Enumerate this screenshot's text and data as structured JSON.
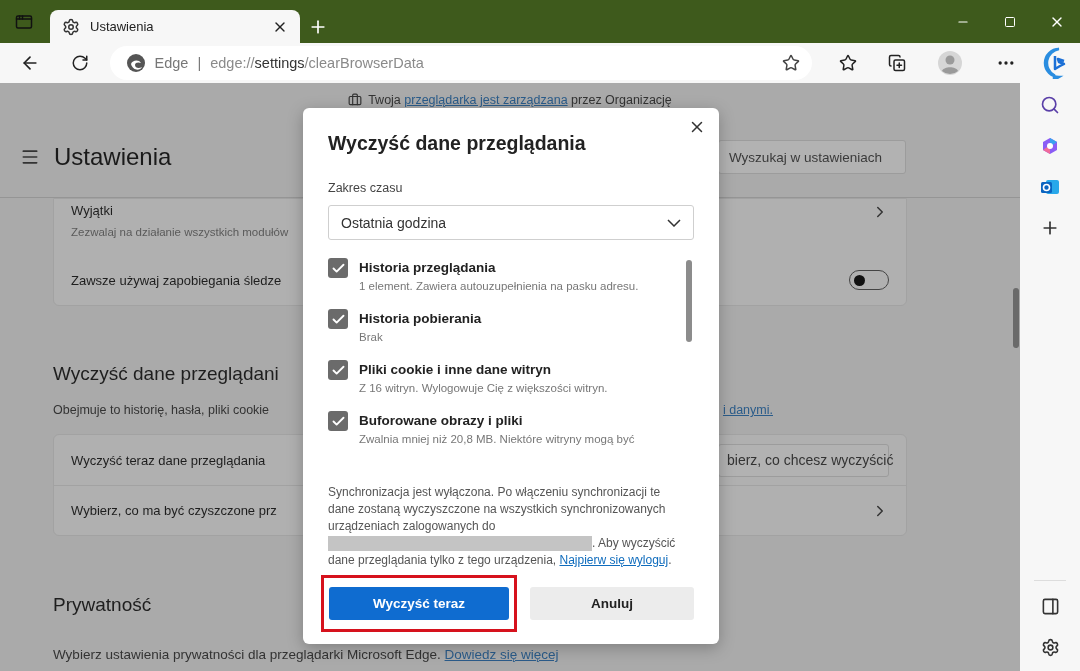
{
  "title_bar": {
    "tab": {
      "title": "Ustawienia",
      "selected": true
    }
  },
  "address_bar": {
    "site_label": "Edge",
    "separator": "|",
    "url_scheme": "edge://",
    "url_host": "settings",
    "url_path": "/clearBrowserData"
  },
  "managed_notice": {
    "before": "Twoja",
    "link": "przeglądarka jest zarządzana",
    "after": "przez Organizację"
  },
  "settings_header": {
    "title": "Ustawienia",
    "search": {
      "placeholder": "Wyszukaj w ustawieniach"
    }
  },
  "tracking_card": {
    "rows": [
      {
        "kind": "link",
        "title": "Wyjątki",
        "description": "Zezwalaj na działanie wszystkich modułów"
      },
      {
        "kind": "toggle",
        "title": "Zawsze używaj zapobiegania śledze",
        "on": false
      }
    ]
  },
  "clear_section": {
    "heading": "Wyczyść dane przeglądani",
    "description": "Obejmuje to historię, hasła, pliki cookie",
    "link": "i danymi.",
    "rows": [
      {
        "kind": "button",
        "title": "Wyczyść teraz dane przeglądania",
        "button": "bierz, co chcesz wyczyścić"
      },
      {
        "kind": "link",
        "title": "Wybierz, co ma być czyszczone prz"
      }
    ]
  },
  "privacy_section": {
    "heading": "Prywatność",
    "description": "Wybierz ustawienia prywatności dla przeglądarki Microsoft Edge.",
    "link": "Dowiedz się więcej"
  },
  "dialog": {
    "title": "Wyczyść dane przeglądania",
    "time_range": {
      "label": "Zakres czasu",
      "value": "Ostatnia godzina"
    },
    "items": [
      {
        "title": "Historia przeglądania",
        "description": "1 element. Zawiera autouzupełnienia na pasku adresu.",
        "checked": true
      },
      {
        "title": "Historia pobierania",
        "description": "Brak",
        "checked": true
      },
      {
        "title": "Pliki cookie i inne dane witryn",
        "description": "Z 16 witryn. Wylogowuje Cię z większości witryn.",
        "checked": true
      },
      {
        "title": "Buforowane obrazy i pliki",
        "description": "Zwalnia mniej niż 20,8 MB. Niektóre witryny mogą być",
        "checked": true
      }
    ],
    "sync_notice": {
      "before": "Synchronizacja jest wyłączona. Po włączeniu synchronizacji te dane zostaną wyczyszczone na wszystkich synchronizowanych urządzeniach zalogowanych do",
      "after": ". Aby wyczyścić dane przeglądania tylko z tego urządzenia,",
      "link": "Najpierw się wyloguj",
      "end": "."
    },
    "buttons": [
      {
        "kind": "primary",
        "label": "Wyczyść teraz",
        "highlighted": true
      },
      {
        "kind": "secondary",
        "label": "Anuluj",
        "highlighted": false
      }
    ]
  }
}
